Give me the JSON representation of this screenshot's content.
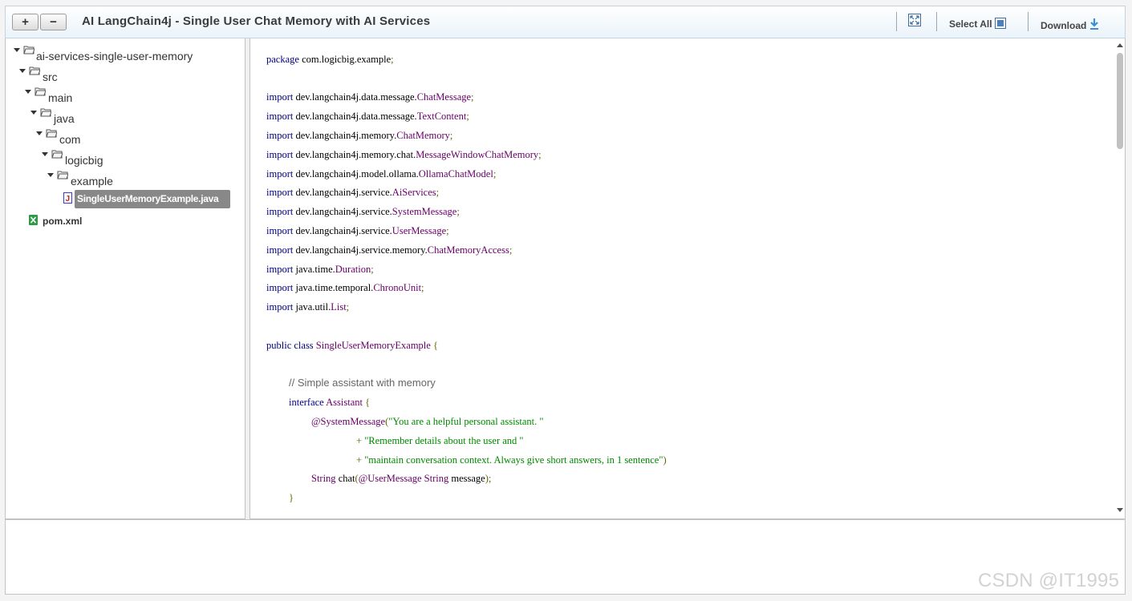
{
  "toolbar": {
    "expand_label": "+",
    "collapse_label": "−",
    "title": "AI LangChain4j - Single User Chat Memory with AI Services",
    "select_all_label": "Select All",
    "download_label": "Download"
  },
  "tree": {
    "nodes": [
      {
        "label": "ai-services-single-user-memory"
      },
      {
        "label": "src"
      },
      {
        "label": "main"
      },
      {
        "label": "java"
      },
      {
        "label": "com"
      },
      {
        "label": "logicbig"
      },
      {
        "label": "example"
      },
      {
        "label": "SingleUserMemoryExample.java"
      },
      {
        "label": "pom.xml"
      }
    ]
  },
  "code": {
    "package_kw": "package",
    "package_name": "com.logicbig.example",
    "imports": [
      {
        "kw": "import",
        "pkg": "dev.langchain4j.data.message.",
        "cls": "ChatMessage"
      },
      {
        "kw": "import",
        "pkg": "dev.langchain4j.data.message.",
        "cls": "TextContent"
      },
      {
        "kw": "import",
        "pkg": "dev.langchain4j.memory.",
        "cls": "ChatMemory"
      },
      {
        "kw": "import",
        "pkg": "dev.langchain4j.memory.chat.",
        "cls": "MessageWindowChatMemory"
      },
      {
        "kw": "import",
        "pkg": "dev.langchain4j.model.ollama.",
        "cls": "OllamaChatModel"
      },
      {
        "kw": "import",
        "pkg": "dev.langchain4j.service.",
        "cls": "AiServices"
      },
      {
        "kw": "import",
        "pkg": "dev.langchain4j.service.",
        "cls": "SystemMessage"
      },
      {
        "kw": "import",
        "pkg": "dev.langchain4j.service.",
        "cls": "UserMessage"
      },
      {
        "kw": "import",
        "pkg": "dev.langchain4j.service.memory.",
        "cls": "ChatMemoryAccess"
      },
      {
        "kw": "import",
        "pkg": "java.time.",
        "cls": "Duration"
      },
      {
        "kw": "import",
        "pkg": "java.time.temporal.",
        "cls": "ChronoUnit"
      },
      {
        "kw": "import",
        "pkg": "java.util.",
        "cls": "List"
      }
    ],
    "class_decl": {
      "kw": "public class",
      "name": "SingleUserMemoryExample",
      "brace": "{"
    },
    "comment": "// Simple assistant with memory",
    "interface_decl": {
      "kw": "interface",
      "name": "Assistant",
      "brace": "{"
    },
    "annotation": "@SystemMessage",
    "str1": "\"You are a helpful personal assistant. \"",
    "str2": "\"Remember details about the user and \"",
    "str3": "\"maintain conversation context. Always give short answers, in 1 sentence\"",
    "method": {
      "type": "String",
      "name": "chat",
      "ann": "@UserMessage",
      "ptype": "String",
      "pname": "message"
    },
    "close_brace": "}"
  },
  "watermark": "CSDN @IT1995"
}
